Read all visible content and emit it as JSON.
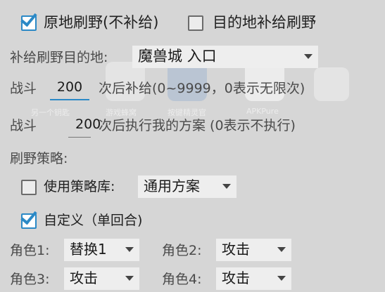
{
  "top": {
    "field_resupply_label": "原地刷野(不补给)",
    "field_resupply_checked": true,
    "dest_resupply_label": "目的地补给刷野",
    "dest_resupply_checked": false
  },
  "destination": {
    "label": "补给刷野目的地:",
    "value": "魔兽城 入口"
  },
  "battle_resupply": {
    "prefix": "战斗",
    "value": "200",
    "suffix": "次后补给(0~9999，0表示无限次)"
  },
  "battle_plan": {
    "prefix": "战斗",
    "value": "200",
    "suffix": "次后执行我的方案 (0表示不执行)"
  },
  "strategy": {
    "heading": "刷野策略:",
    "use_library_label": "使用策略库:",
    "use_library_checked": false,
    "library_value": "通用方案",
    "custom_label": "自定义（单回合)",
    "custom_checked": true
  },
  "roles": [
    {
      "label": "角色1:",
      "value": "替换1"
    },
    {
      "label": "角色2:",
      "value": "攻击"
    },
    {
      "label": "角色3:",
      "value": "攻击"
    },
    {
      "label": "角色4:",
      "value": "攻击"
    }
  ],
  "background_apps": [
    "另一个钥匙",
    "游戏蜂窝",
    "按键精灵官",
    "APKPure"
  ],
  "colors": {
    "accent": "#2b89c6",
    "background": "#d6d6d6",
    "control": "#eeeeee"
  }
}
